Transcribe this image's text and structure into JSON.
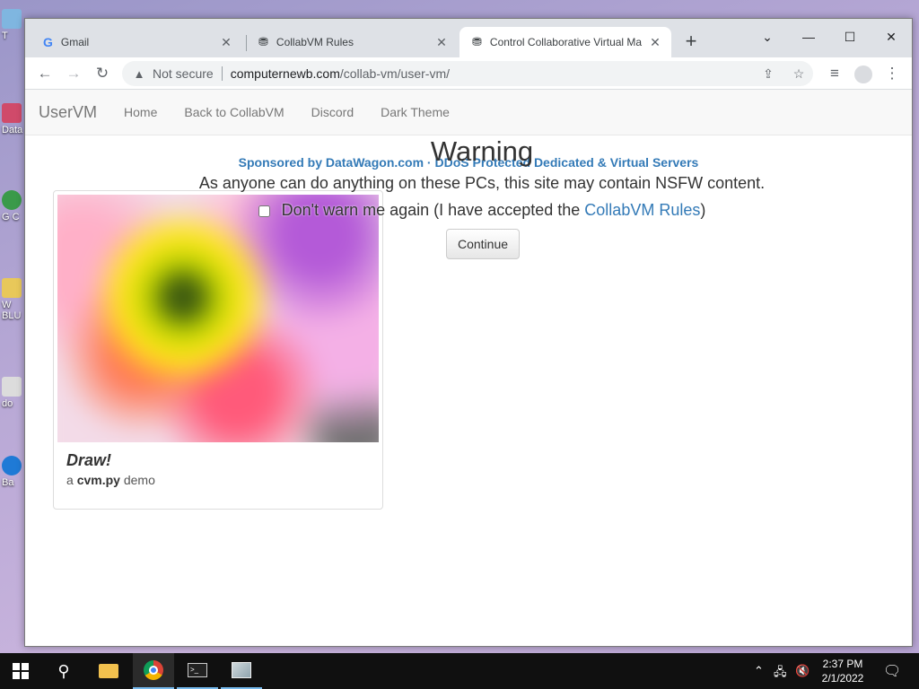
{
  "desktop": {
    "icons": [
      {
        "label": "T"
      },
      {
        "label": "Data"
      },
      {
        "label": "G C"
      },
      {
        "label": "W BLU"
      },
      {
        "label": "do"
      },
      {
        "label": "Ba"
      }
    ]
  },
  "browser": {
    "tabs": [
      {
        "title": "Gmail",
        "icon": "google-g-icon"
      },
      {
        "title": "CollabVM Rules",
        "icon": "collabvm-icon"
      },
      {
        "title": "Control Collaborative Virtual Ma",
        "icon": "collabvm-icon",
        "active": true
      }
    ],
    "new_tab": "+",
    "address": {
      "security": "Not secure",
      "host": "computernewb.com",
      "path": "/collab-vm/user-vm/"
    }
  },
  "page": {
    "brand": "UserVM",
    "nav": [
      "Home",
      "Back to CollabVM",
      "Discord",
      "Dark Theme"
    ],
    "sponsor": "Sponsored by DataWagon.com · DDoS Protected Dedicated & Virtual Servers",
    "card": {
      "title": "Draw!",
      "sub_prefix": "a",
      "sub_bold": "cvm.py",
      "sub_suffix": "demo"
    },
    "warning": {
      "heading": "Warning",
      "text": "As anyone can do anything on these PCs, this site may contain NSFW content.",
      "checkbox_label": "Don't warn me again (I have accepted the",
      "rules_link": "CollabVM Rules",
      "checkbox_suffix": ")",
      "continue": "Continue"
    }
  },
  "taskbar": {
    "time": "2:37 PM",
    "date": "2/1/2022"
  },
  "colors": {
    "link": "#337ab7",
    "taskbar": "#101010",
    "accent": "#76b9ed"
  }
}
